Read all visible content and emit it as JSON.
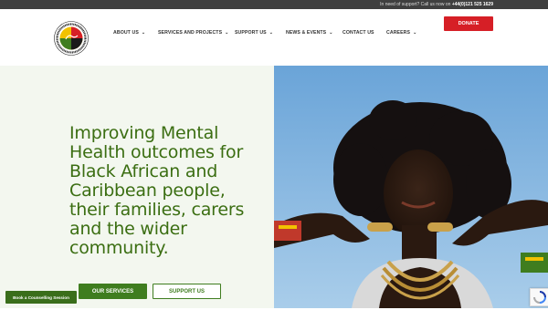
{
  "topbar": {
    "support_text": "In need of support? Call us now on",
    "phone": "+44(0)121 525 1629"
  },
  "logo": {
    "ring_text": "SANDWELL AFRICAN CARIBBEAN MENTAL HEALTH FOUNDATION"
  },
  "nav": {
    "items": [
      {
        "label": "ABOUT US",
        "icon": "chevron-down-icon"
      },
      {
        "label": "SERVICES AND PROJECTS",
        "icon": "chevron-down-icon"
      },
      {
        "label": "SUPPORT US",
        "icon": "chevron-down-icon"
      },
      {
        "label": "NEWS & EVENTS",
        "icon": "chevron-down-icon"
      },
      {
        "label": "CONTACT US",
        "icon": ""
      },
      {
        "label": "CAREERS",
        "icon": "chevron-down-icon"
      }
    ],
    "donate_label": "DONATE"
  },
  "hero": {
    "title": "Improving Mental Health outcomes for Black African and Caribbean people, their families, carers and the wider community.",
    "primary_button": "OUR SERVICES",
    "secondary_button": "SUPPORT US",
    "image": "smiling-woman-afro-blue-sky"
  },
  "booking_button": "Book a Counselling Session",
  "colors": {
    "brand_green": "#3f7d1f",
    "title_green": "#3b6e12",
    "donate_red": "#d61f26",
    "topbar_bg": "#3f3f3f",
    "hero_bg": "#f3f7ef",
    "sky_blue": "#7fb2dc"
  }
}
